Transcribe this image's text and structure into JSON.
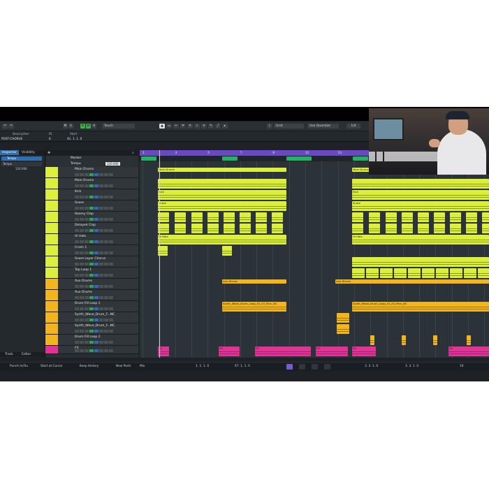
{
  "toolbar": {
    "buttons": [
      "M",
      "S",
      "R",
      "W",
      "A"
    ],
    "automation_mode": "Touch",
    "snap_type": "Grid",
    "quantize_mode": "Use Quantize",
    "quantize_value": "1/4"
  },
  "info_bar": {
    "description_label": "Description",
    "id_label": "ID",
    "start_label": "Start",
    "description_value": "POST-CHORUS",
    "id_value": "6",
    "start_value": "41. 1. 1. 0"
  },
  "inspector": {
    "tab_inspector": "Inspector",
    "tab_visibility": "Visibility",
    "track_name": "Tempo",
    "tempo_value": "120.000",
    "bottom_tab_track": "Track",
    "bottom_tab_editor": "Editor"
  },
  "tracks": [
    {
      "name": "Marker"
    },
    {
      "name": "Tempo",
      "value": "120.000"
    },
    {
      "name": "Main Drums",
      "color": "#dcef3c"
    },
    {
      "name": "Main Drums",
      "color": "#dcef3c"
    },
    {
      "name": "Kick",
      "color": "#dcef3c"
    },
    {
      "name": "Snare",
      "color": "#dcef3c"
    },
    {
      "name": "Roomy Clap",
      "color": "#dcef3c"
    },
    {
      "name": "Delayed Clap",
      "color": "#dcef3c"
    },
    {
      "name": "Hi Hats",
      "color": "#dcef3c"
    },
    {
      "name": "Crash 1",
      "color": "#dcef3c"
    },
    {
      "name": "Snare Layer Chorus",
      "color": "#dcef3c"
    },
    {
      "name": "Top Loop 1",
      "color": "#dcef3c"
    },
    {
      "name": "Aux Drums",
      "color": "#f2b51d"
    },
    {
      "name": "Aux Drums",
      "color": "#f2b51d"
    },
    {
      "name": "Drum Fill Loop 1",
      "color": "#f2b51d"
    },
    {
      "name": "Synth_Wave_Drum_F...NC",
      "color": "#f2b51d"
    },
    {
      "name": "Synth_Wave_Drum_F...NC",
      "color": "#f2b51d"
    },
    {
      "name": "Drum Fill Loop 2",
      "color": "#f2b51d"
    },
    {
      "name": "FX",
      "color": "#e2329a"
    }
  ],
  "ruler": [
    "1",
    "3",
    "5",
    "7",
    "9",
    "11",
    "13",
    "15",
    "17",
    "19",
    "21",
    "23",
    "25",
    "27",
    "29"
  ],
  "clip_labels": {
    "main_drums": "Main Drums",
    "kick": "Kick",
    "snare": "Snare",
    "hihats": "Hi Hats",
    "aux_drums": "Aux Drums",
    "synth_loop": "Synth_Wave_Drum_Loop_01_01_Perc_NC",
    "fx": "FX"
  },
  "transport": {
    "punch_mode": "Punch In/Ou",
    "start_mode": "Start at Cursor",
    "history_mode": "Keep History",
    "new_parts": "New Parts",
    "mix": "Mix",
    "left_locator": "1. 1. 1. 0",
    "right_locator": "67. 1. 1. 0",
    "position": "3. 3. 1. 0",
    "position2": "3. 3. 1. 0",
    "tempo_val": "16"
  },
  "colors": {
    "lime": "#dcef3c",
    "amber": "#f2b51d",
    "pink": "#e2329a",
    "ruler": "#6a49c9",
    "marker": "#25b35f"
  }
}
